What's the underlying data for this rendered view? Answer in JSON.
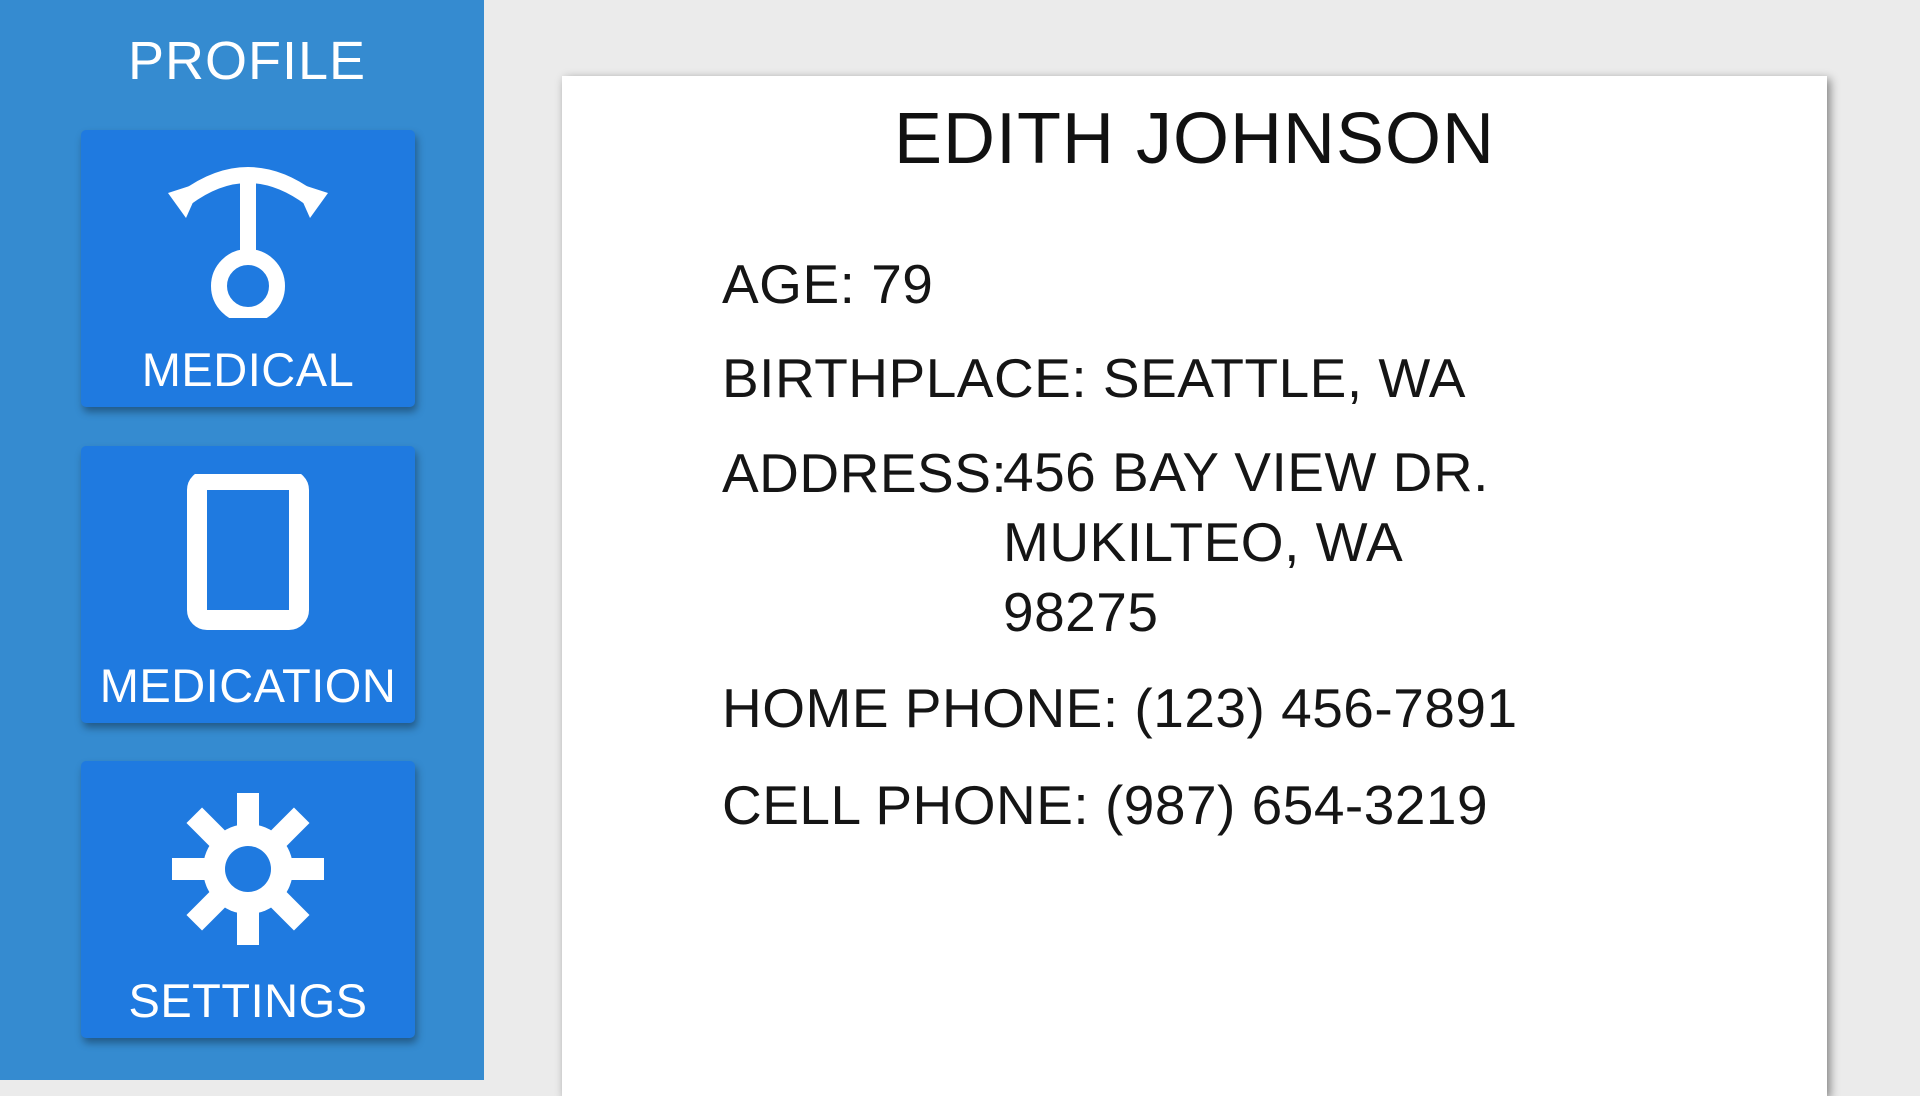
{
  "sidebar": {
    "title": "PROFILE",
    "items": [
      {
        "label": "MEDICAL",
        "icon": "stethoscope-icon"
      },
      {
        "label": "MEDICATION",
        "icon": "tablet-icon"
      },
      {
        "label": "SETTINGS",
        "icon": "gear-icon"
      }
    ]
  },
  "profile": {
    "name": "EDITH JOHNSON",
    "age": "AGE: 79",
    "birthplace": "BIRTHPLACE: SEATTLE, WA",
    "address_label": "ADDRESS:",
    "address_lines": [
      "456 BAY VIEW DR.",
      "MUKILTEO, WA",
      "98275"
    ],
    "home_phone": "HOME PHONE: (123) 456-7891",
    "cell_phone": "CELL PHONE: (987) 654-3219"
  },
  "colors": {
    "sidebar_bg": "#358bd0",
    "tile_bg": "#1f7ae0",
    "page_bg": "#ebebeb",
    "card_bg": "#ffffff"
  }
}
